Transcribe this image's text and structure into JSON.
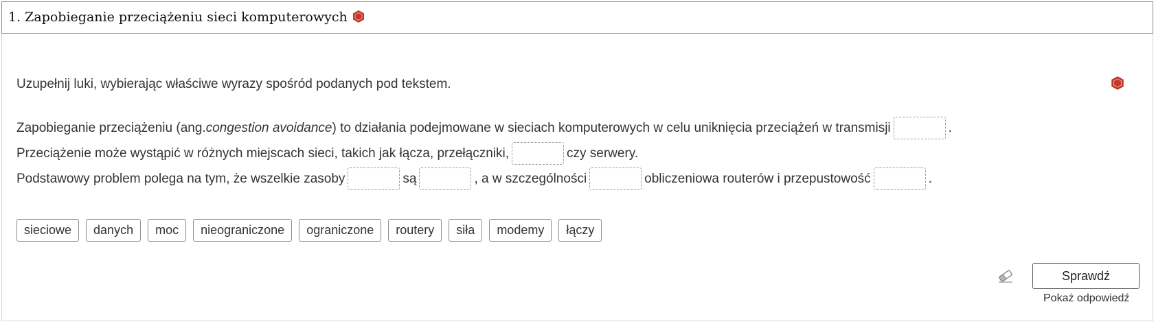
{
  "header": {
    "title": "1. Zapobieganie przeciążeniu sieci komputerowych",
    "icon": "hexagon-badge-icon",
    "icon_color": "#c0392b"
  },
  "instruction": "Uzupełnij luki, wybierając właściwe wyrazy spośród podanych pod tekstem.",
  "text": {
    "line1_part1": "Zapobieganie przeciążeniu (ang. ",
    "line1_italic": "congestion avoidance",
    "line1_part2": ") to działania podejmowane w sieciach komputerowych w celu uniknięcia przeciążeń w transmisji",
    "line1_end": ".",
    "line2_part1": "Przeciążenie może wystąpić w różnych miejscach sieci, takich jak łącza, przełączniki,",
    "line2_part2": "czy serwery.",
    "line3_part1": "Podstawowy problem polega na tym, że wszelkie zasoby",
    "line3_part2": "są",
    "line3_part3": ", a w szczególności",
    "line3_part4": "obliczeniowa routerów i przepustowość",
    "line3_end": "."
  },
  "word_bank": [
    "sieciowe",
    "danych",
    "moc",
    "nieograniczone",
    "ograniczone",
    "routery",
    "siła",
    "modemy",
    "łączy"
  ],
  "actions": {
    "check_label": "Sprawdź",
    "show_answer_label": "Pokaż odpowiedź",
    "reset_icon": "eraser-icon"
  }
}
